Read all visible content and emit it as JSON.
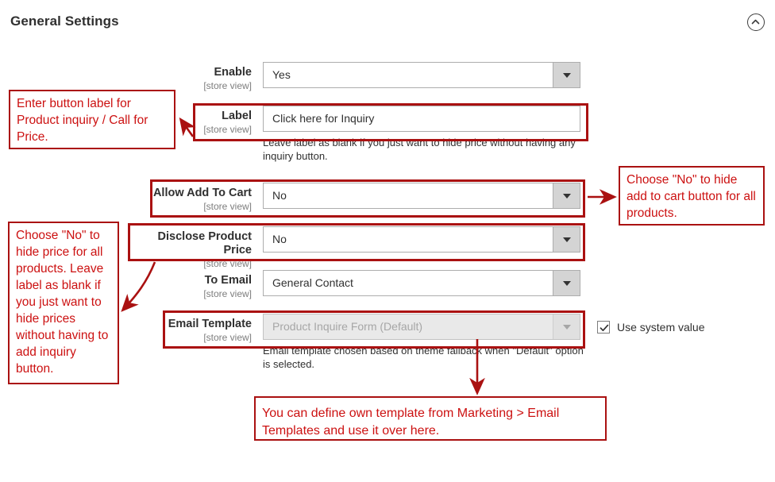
{
  "header": {
    "title": "General Settings",
    "collapse_icon": "chevron-up-circle-icon"
  },
  "fields": [
    {
      "name": "Enable",
      "scope": "[store view]",
      "type": "select",
      "value": "Yes",
      "hint": ""
    },
    {
      "name": "Label",
      "scope": "[store view]",
      "type": "text",
      "value": "Click here for Inquiry",
      "hint": "Leave label as blank if you just want to hide price without having any inquiry button."
    },
    {
      "name": "Allow Add To Cart",
      "scope": "[store view]",
      "type": "select",
      "value": "No",
      "hint": ""
    },
    {
      "name": "Disclose Product Price",
      "scope": "[store view]",
      "type": "select",
      "value": "No",
      "hint": ""
    },
    {
      "name": "To Email",
      "scope": "[store view]",
      "type": "select",
      "value": "General Contact",
      "hint": ""
    },
    {
      "name": "Email Template",
      "scope": "[store view]",
      "type": "select-disabled",
      "value": "Product Inquire Form (Default)",
      "hint": "Email template chosen based on theme fallback when \"Default\" option is selected."
    }
  ],
  "system_value": {
    "label": "Use system value",
    "checked": true
  },
  "annotations": [
    {
      "id": "label-note",
      "text": "Enter button label for Product inquiry / Call for Price."
    },
    {
      "id": "addtocart-note",
      "text": "Choose \"No\" to hide add to cart button for all products."
    },
    {
      "id": "disclose-note",
      "text": "Choose \"No\" to hide price for all products. Leave label as blank if you just want to hide prices without having to add inquiry button."
    },
    {
      "id": "template-note",
      "text": "You can define own template from Marketing > Email Templates and use it over here."
    }
  ],
  "colors": {
    "annotation_red": "#cc1111",
    "highlight_red": "#aa1111",
    "text": "#303030",
    "scope_gray": "#7d7d7d"
  }
}
